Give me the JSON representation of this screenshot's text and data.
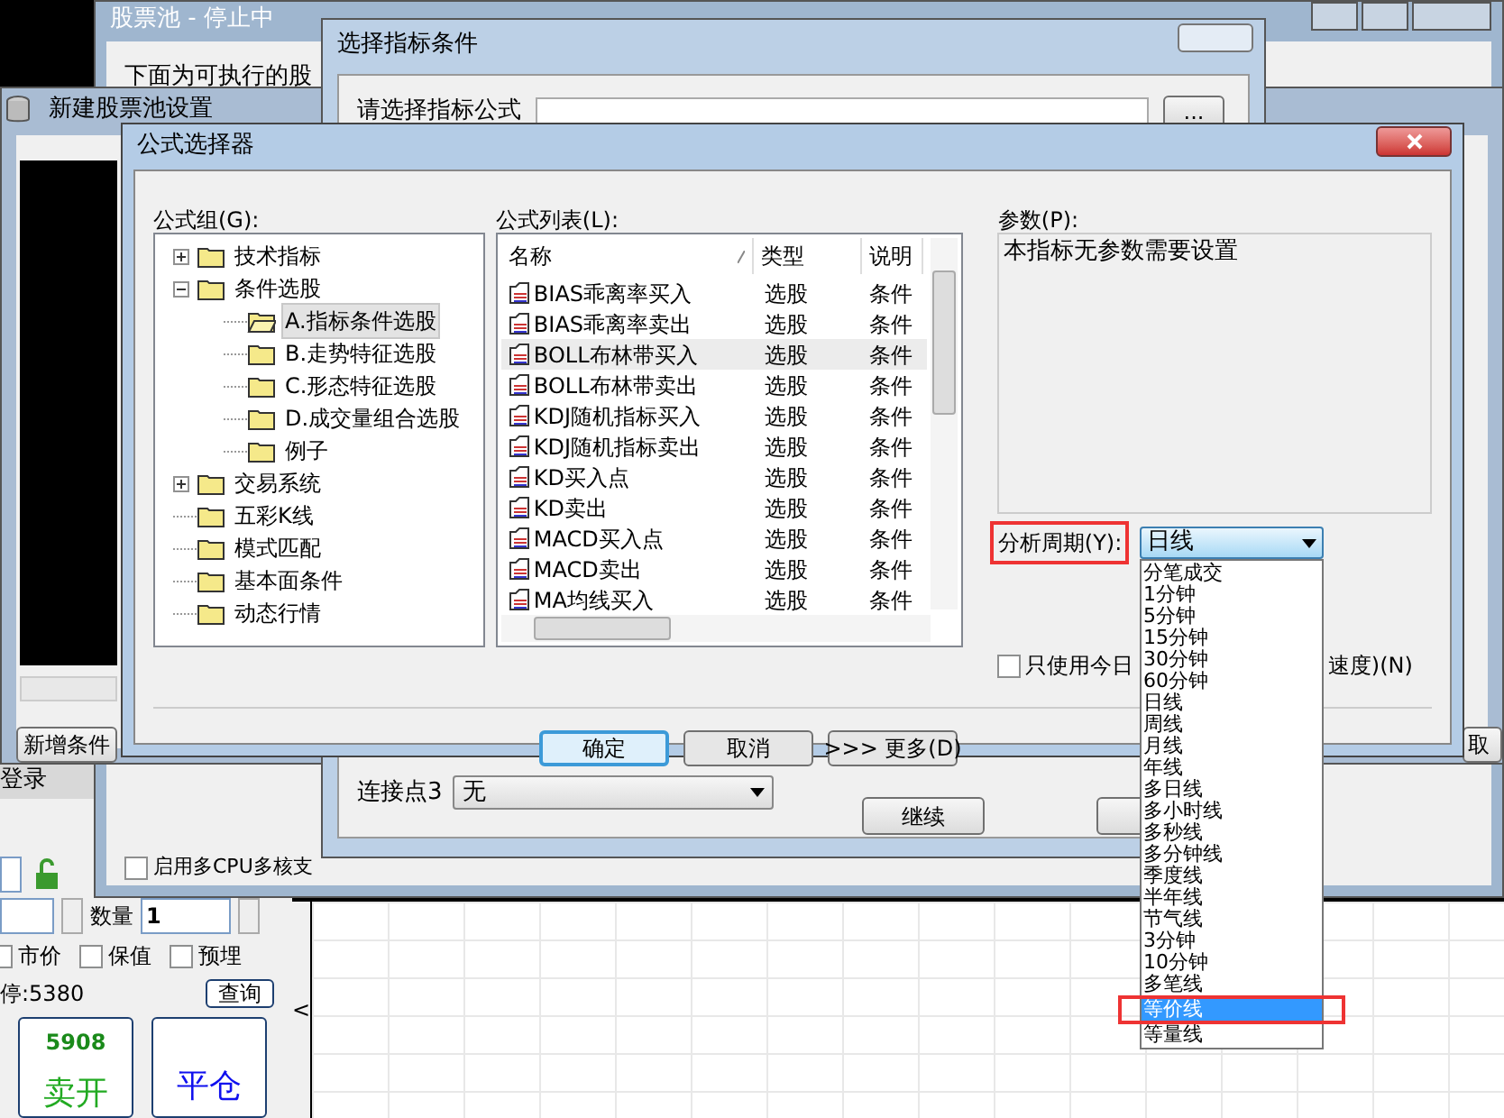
{
  "stock_pool_window": {
    "title": "股票池 - 停止中",
    "notice": "下面为可执行的股",
    "multicore": {
      "label": "启用多CPU多核支",
      "checked": false
    }
  },
  "indicator_window": {
    "title": "选择指标条件",
    "formula_label": "请选择指标公式",
    "browse_button": "...",
    "connect_label": "连接点3",
    "connect_value": "无",
    "continue_button": "继续"
  },
  "new_pool_window": {
    "title": "新建股票池设置",
    "add_button": "新增条件",
    "cancel_button": "取"
  },
  "formula_selector": {
    "title": "公式选择器",
    "group_label": "公式组(G):",
    "list_label": "公式列表(L):",
    "params_label": "参数(P):",
    "params_text": "本指标无参数需要设置",
    "tree": [
      {
        "label": "技术指标",
        "expanded": false,
        "selected": false
      },
      {
        "label": "条件选股",
        "expanded": true,
        "selected": false,
        "children": [
          {
            "label": "A.指标条件选股",
            "selected": true
          },
          {
            "label": "B.走势特征选股",
            "selected": false
          },
          {
            "label": "C.形态特征选股",
            "selected": false
          },
          {
            "label": "D.成交量组合选股",
            "selected": false
          },
          {
            "label": "例子",
            "selected": false
          }
        ]
      },
      {
        "label": "交易系统",
        "expanded": false,
        "selected": false
      },
      {
        "label": "五彩K线",
        "selected": false
      },
      {
        "label": "模式匹配",
        "selected": false
      },
      {
        "label": "基本面条件",
        "selected": false
      },
      {
        "label": "动态行情",
        "selected": false
      }
    ],
    "columns": [
      "名称",
      "类型",
      "说明"
    ],
    "rows": [
      {
        "name": "BIAS乖离率买入",
        "type": "选股",
        "desc": "条件",
        "selected": false
      },
      {
        "name": "BIAS乖离率卖出",
        "type": "选股",
        "desc": "条件",
        "selected": false
      },
      {
        "name": "BOLL布林带买入",
        "type": "选股",
        "desc": "条件",
        "selected": true
      },
      {
        "name": "BOLL布林带卖出",
        "type": "选股",
        "desc": "条件",
        "selected": false
      },
      {
        "name": "KDJ随机指标买入",
        "type": "选股",
        "desc": "条件",
        "selected": false
      },
      {
        "name": "KDJ随机指标卖出",
        "type": "选股",
        "desc": "条件",
        "selected": false
      },
      {
        "name": "KD买入点",
        "type": "选股",
        "desc": "条件",
        "selected": false
      },
      {
        "name": "KD卖出",
        "type": "选股",
        "desc": "条件",
        "selected": false
      },
      {
        "name": "MACD买入点",
        "type": "选股",
        "desc": "条件",
        "selected": false
      },
      {
        "name": "MACD卖出",
        "type": "选股",
        "desc": "条件",
        "selected": false
      },
      {
        "name": "MA均线买入",
        "type": "选股",
        "desc": "条件",
        "selected": false
      }
    ],
    "period": {
      "label": "分析周期(Y):",
      "value": "日线",
      "options": [
        {
          "label": "分笔成交",
          "highlighted": false
        },
        {
          "label": "1分钟",
          "highlighted": false
        },
        {
          "label": "5分钟",
          "highlighted": false
        },
        {
          "label": "15分钟",
          "highlighted": false
        },
        {
          "label": "30分钟",
          "highlighted": false
        },
        {
          "label": "60分钟",
          "highlighted": false
        },
        {
          "label": "日线",
          "highlighted": false
        },
        {
          "label": "周线",
          "highlighted": false
        },
        {
          "label": "月线",
          "highlighted": false
        },
        {
          "label": "年线",
          "highlighted": false
        },
        {
          "label": "多日线",
          "highlighted": false
        },
        {
          "label": "多小时线",
          "highlighted": false
        },
        {
          "label": "多秒线",
          "highlighted": false
        },
        {
          "label": "多分钟线",
          "highlighted": false
        },
        {
          "label": "季度线",
          "highlighted": false
        },
        {
          "label": "半年线",
          "highlighted": false
        },
        {
          "label": "节气线",
          "highlighted": false
        },
        {
          "label": "3分钟",
          "highlighted": false
        },
        {
          "label": "10分钟",
          "highlighted": false
        },
        {
          "label": "多笔线",
          "highlighted": false
        },
        {
          "label": "等价线",
          "highlighted": true
        },
        {
          "label": "等量线",
          "highlighted": false
        }
      ]
    },
    "today_only": {
      "label_start": "只使用今日",
      "label_end": "速度)(N)",
      "checked": false
    },
    "buttons": [
      {
        "label": "确定",
        "default": true
      },
      {
        "label": "取消",
        "default": false
      },
      {
        "label": ">>> 更多(D)",
        "default": false
      }
    ]
  },
  "trade_panel": {
    "status": "登录",
    "quantity_label": "数量",
    "quantity": "1",
    "options": [
      {
        "label": "市价",
        "checked": false
      },
      {
        "label": "保值",
        "checked": false
      },
      {
        "label": "预埋",
        "checked": false
      }
    ],
    "limit": "停:5380",
    "query_button": "查询",
    "sell": {
      "price": "5908",
      "label": "卖开"
    },
    "close_button": "平仓",
    "collapse": "<"
  }
}
